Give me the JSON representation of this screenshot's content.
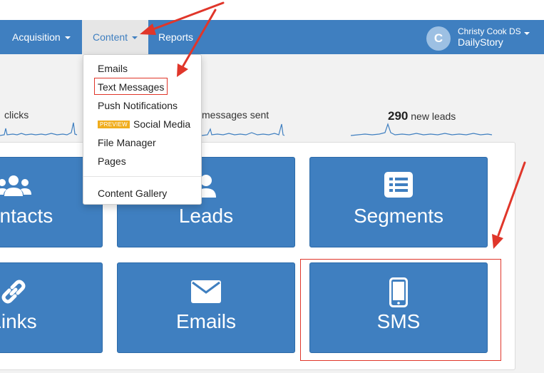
{
  "nav": {
    "acquisition": "Acquisition",
    "content": "Content",
    "reports": "Reports"
  },
  "user": {
    "initial": "C",
    "name": "Christy Cook DS",
    "company": "DailyStory"
  },
  "dropdown": {
    "emails": "Emails",
    "text_messages": "Text Messages",
    "push_notifications": "Push Notifications",
    "preview_badge": "PREVIEW",
    "social_media": "Social Media",
    "file_manager": "File Manager",
    "pages": "Pages",
    "content_gallery": "Content Gallery"
  },
  "stats": {
    "clicks_label": "clicks",
    "messages_label": "messages sent",
    "leads_value": "290",
    "leads_label": "new leads"
  },
  "tiles": {
    "contacts": "Contacts",
    "leads": "Leads",
    "segments": "Segments",
    "links": "Links",
    "emails": "Emails",
    "sms": "SMS"
  },
  "colors": {
    "brand_blue": "#3f7fc0",
    "highlight_red": "#e0362a",
    "badge_orange": "#f0ad1e"
  },
  "icons": {
    "contacts": "users-icon",
    "leads": "user-icon",
    "segments": "list-icon",
    "links": "link-icon",
    "emails": "envelope-icon",
    "sms": "mobile-phone-icon"
  }
}
